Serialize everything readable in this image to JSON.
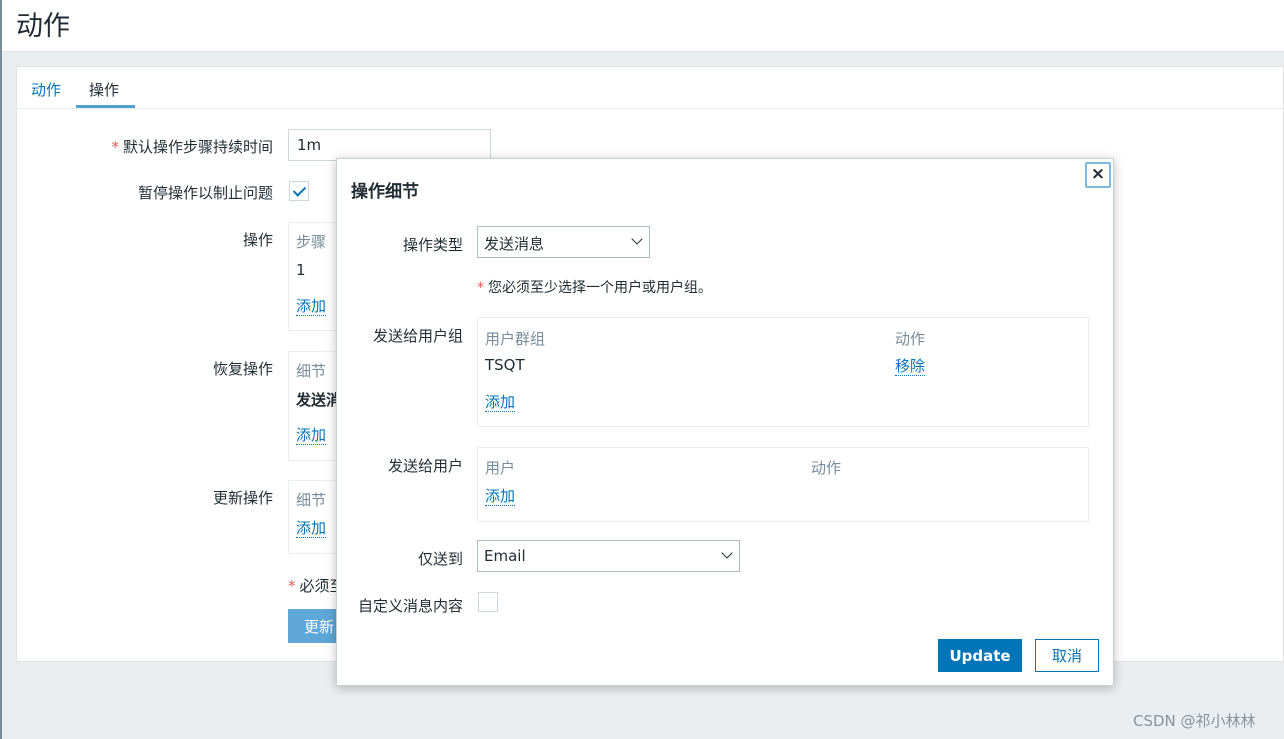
{
  "page": {
    "title": "动作"
  },
  "tabs": [
    {
      "label": "动作"
    },
    {
      "label": "操作"
    }
  ],
  "form": {
    "default_step_duration": {
      "label": "默认操作步骤持续时间",
      "value": "1m"
    },
    "pause_label": "暂停操作以制止问题",
    "pause_checked": true,
    "operations": {
      "label": "操作",
      "header": "步骤",
      "row_text": "1",
      "add": "添加"
    },
    "recovery": {
      "label": "恢复操作",
      "header": "细节",
      "row_text": "发送消",
      "add": "添加"
    },
    "update_ops": {
      "label": "更新操作",
      "header": "细节",
      "add": "添加"
    },
    "required_note": "必须至",
    "update_button": "更新"
  },
  "dialog": {
    "title": "操作细节",
    "close_symbol": "×",
    "operation_type": {
      "label": "操作类型",
      "value": "发送消息"
    },
    "required_note": "您必须至少选择一个用户或用户组。",
    "user_groups": {
      "label": "发送给用户组",
      "col_name": "用户群组",
      "col_action": "动作",
      "rows": [
        {
          "name": "TSQT",
          "action": "移除"
        }
      ],
      "add": "添加"
    },
    "users": {
      "label": "发送给用户",
      "col_name": "用户",
      "col_action": "动作",
      "add": "添加"
    },
    "send_only_to": {
      "label": "仅送到",
      "value": "Email"
    },
    "custom_message": {
      "label": "自定义消息内容",
      "checked": false
    },
    "update_button": "Update",
    "cancel_button": "取消"
  },
  "watermark": "CSDN @祁小林林",
  "colors": {
    "accent": "#0275b8",
    "required": "#e45959"
  }
}
